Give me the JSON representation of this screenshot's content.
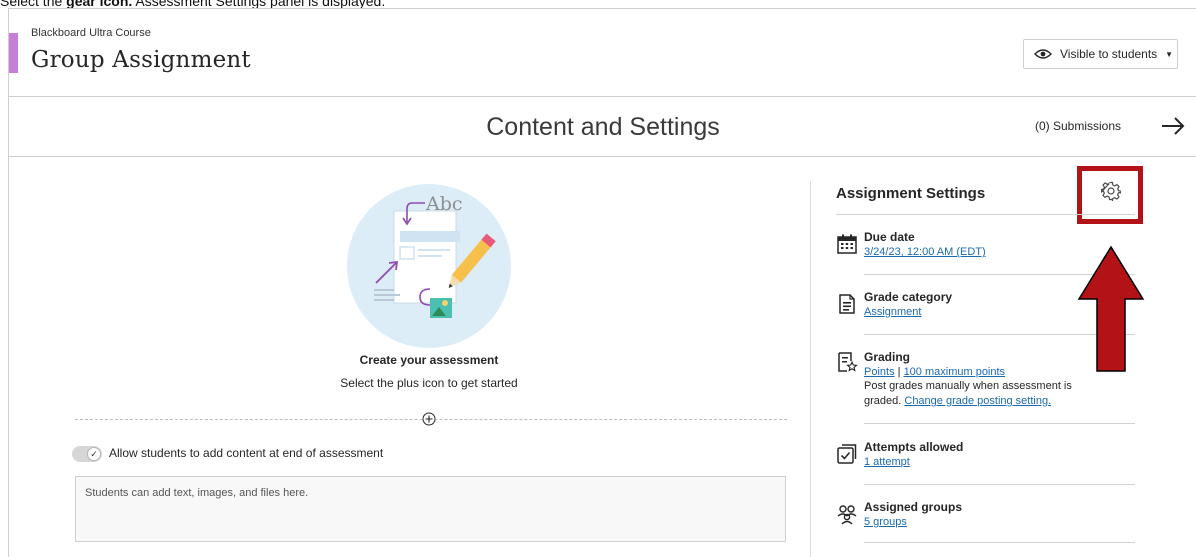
{
  "caption": {
    "prefix": "Select the ",
    "bold": "gear icon.",
    "suffix": " Assessment Settings panel is displayed."
  },
  "header": {
    "course_name": "Blackboard Ultra Course",
    "title": "Group Assignment",
    "visibility_label": "Visible to students"
  },
  "section": {
    "title": "Content and Settings",
    "submissions": "(0) Submissions"
  },
  "content": {
    "illustration_text": "Abc",
    "create_title": "Create your assessment",
    "create_subtitle": "Select the plus icon to get started",
    "toggle_label": "Allow students to add content at end of assessment",
    "toggle_on": true,
    "textbox_placeholder": "Students can add text, images, and files here."
  },
  "settings": {
    "title": "Assignment Settings",
    "due_date": {
      "label": "Due date",
      "value": "3/24/23, 12:00 AM (EDT)"
    },
    "grade_category": {
      "label": "Grade category",
      "value": "Assignment"
    },
    "grading": {
      "label": "Grading",
      "type": "Points",
      "separator": "|",
      "max_points": "100 maximum points",
      "note_line1": "Post grades manually when assessment is",
      "note_line2_prefix": "graded.",
      "note_link": "Change grade posting setting."
    },
    "attempts": {
      "label": "Attempts allowed",
      "value": "1 attempt"
    },
    "groups": {
      "label": "Assigned groups",
      "value": "5 groups"
    }
  },
  "icons": {
    "visibility": "eye-icon",
    "next": "arrow-right-icon",
    "add": "plus-circle-icon",
    "settings": "gear-icon",
    "due_date": "calendar-icon",
    "grade_category": "document-icon",
    "grading": "grading-icon",
    "attempts": "checkbox-icon",
    "groups": "group-icon"
  },
  "colors": {
    "accent_purple": "#c77ed6",
    "link_blue": "#1b6bb0",
    "highlight_red": "#b31317",
    "illustration_bg": "#dcedf8"
  }
}
